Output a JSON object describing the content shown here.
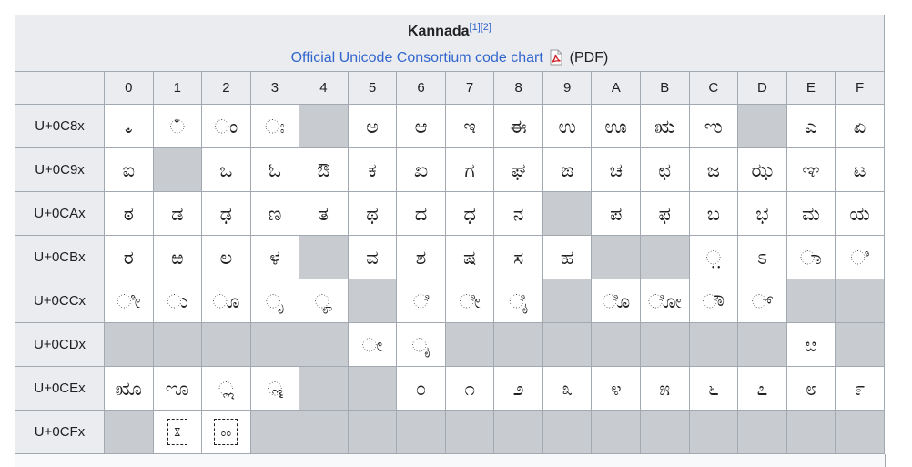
{
  "title": "Kannada",
  "refs": [
    "[1]",
    "[2]"
  ],
  "chart_link": "Official Unicode Consortium code chart",
  "pdf_label": "(PDF)",
  "columns": [
    "0",
    "1",
    "2",
    "3",
    "4",
    "5",
    "6",
    "7",
    "8",
    "9",
    "A",
    "B",
    "C",
    "D",
    "E",
    "F"
  ],
  "rows": [
    {
      "label": "U+0C8x",
      "cells": [
        "ಀ",
        "ಁ",
        "ಂ",
        "ಃ",
        "",
        "ಅ",
        "ಆ",
        "ಇ",
        "ಈ",
        "ಉ",
        "ಊ",
        "ಋ",
        "ಌ",
        "",
        "ಎ",
        "ಏ"
      ]
    },
    {
      "label": "U+0C9x",
      "cells": [
        "ಐ",
        "",
        "ಒ",
        "ಓ",
        "ಔ",
        "ಕ",
        "ಖ",
        "ಗ",
        "ಘ",
        "ಙ",
        "ಚ",
        "ಛ",
        "ಜ",
        "ಝ",
        "ಞ",
        "ಟ"
      ]
    },
    {
      "label": "U+0CAx",
      "cells": [
        "ಠ",
        "ಡ",
        "ಢ",
        "ಣ",
        "ತ",
        "ಥ",
        "ದ",
        "ಧ",
        "ನ",
        "",
        "ಪ",
        "ಫ",
        "ಬ",
        "ಭ",
        "ಮ",
        "ಯ"
      ]
    },
    {
      "label": "U+0CBx",
      "cells": [
        "ರ",
        "ಱ",
        "ಲ",
        "ಳ",
        "",
        "ವ",
        "ಶ",
        "ಷ",
        "ಸ",
        "ಹ",
        "",
        "",
        "಼",
        "ಽ",
        "ಾ",
        "ಿ"
      ]
    },
    {
      "label": "U+0CCx",
      "cells": [
        "ೀ",
        "ು",
        "ೂ",
        "ೃ",
        "ೄ",
        "",
        "ೆ",
        "ೇ",
        "ೈ",
        "",
        "ೊ",
        "ೋ",
        "ೌ",
        "್",
        "",
        ""
      ]
    },
    {
      "label": "U+0CDx",
      "cells": [
        "",
        "",
        "",
        "",
        "",
        "ೕ",
        "ೖ",
        "",
        "",
        "",
        "",
        "",
        "",
        "",
        "ೞ",
        ""
      ]
    },
    {
      "label": "U+0CEx",
      "cells": [
        "ೠ",
        "ೡ",
        "ೢ",
        "ೣ",
        "",
        "",
        "೦",
        "೧",
        "೨",
        "೩",
        "೪",
        "೫",
        "೬",
        "೭",
        "೮",
        "೯"
      ]
    },
    {
      "label": "U+0CFx",
      "cells": [
        "",
        "ೱ",
        "ೲ",
        "",
        "",
        "",
        "",
        "",
        "",
        "",
        "",
        "",
        "",
        "",
        "",
        ""
      ]
    }
  ],
  "dashed_cells": [
    "U+0CFx-1",
    "U+0CFx-2"
  ],
  "colors": {
    "link": "#3366cc",
    "empty_cell": "#c8ccd1",
    "header_bg": "#eaecf0",
    "border": "#a2a9b1"
  }
}
